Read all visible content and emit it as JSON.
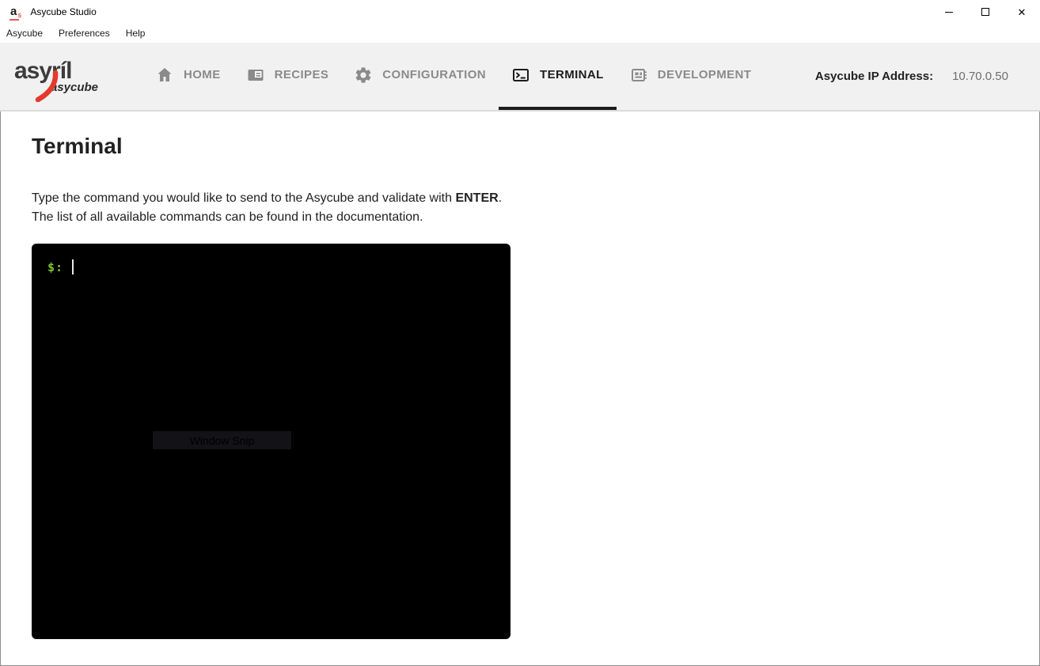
{
  "window": {
    "title": "Asycube Studio",
    "app_icon_letter": "a",
    "app_icon_sub": "s",
    "close_glyph": "✕"
  },
  "menubar": {
    "items": [
      "Asycube",
      "Preferences",
      "Help"
    ]
  },
  "header": {
    "logo": {
      "primary": "asyríl",
      "secondary": "asycube"
    },
    "nav": [
      {
        "label": "HOME",
        "icon": "home-icon",
        "active": false
      },
      {
        "label": "RECIPES",
        "icon": "recipes-icon",
        "active": false
      },
      {
        "label": "CONFIGURATION",
        "icon": "settings-gear-icon",
        "active": false
      },
      {
        "label": "TERMINAL",
        "icon": "terminal-icon",
        "active": true
      },
      {
        "label": "DEVELOPMENT",
        "icon": "developer-board-icon",
        "active": false
      }
    ],
    "ip_label": "Asycube IP Address:",
    "ip_value": "10.70.0.50"
  },
  "main": {
    "title": "Terminal",
    "instructions": {
      "line1_text": "Type the command you would like to send to the Asycube and validate with ",
      "line1_bold": "ENTER",
      "line1_end": ".",
      "line2": "The list of all available commands can be found in the documentation."
    },
    "terminal": {
      "prompt": "$:",
      "overlay_text": "Window Snip"
    }
  },
  "colors": {
    "brand_red": "#e23b2e",
    "terminal_green": "#7dc62c",
    "nav_active": "#1c1c1c",
    "nav_inactive": "#8a8a8a",
    "header_bg": "#f1f1f1"
  }
}
